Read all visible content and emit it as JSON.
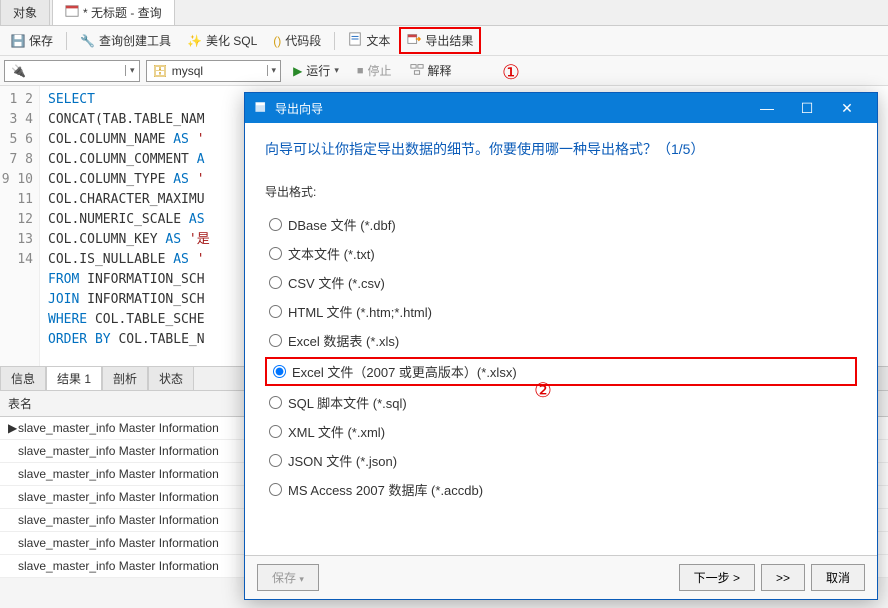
{
  "tabs": {
    "object": "对象",
    "query": "* 无标题 - 查询"
  },
  "toolbar": {
    "save": "保存",
    "query_builder": "查询创建工具",
    "beautify_sql": "美化 SQL",
    "code_snippet": "代码段",
    "text": "文本",
    "export_result": "导出结果"
  },
  "toolbar2": {
    "db": "mysql",
    "run": "运行",
    "stop": "停止",
    "explain": "解释"
  },
  "code": {
    "lines": [
      {
        "n": "1",
        "t": "SELECT",
        "cls": "kw"
      },
      {
        "n": "2",
        "t": "CONCAT(TAB.TABLE_NAM"
      },
      {
        "n": "3",
        "t": "COL.COLUMN_NAME AS '",
        "kw": "AS"
      },
      {
        "n": "4",
        "t": "COL.COLUMN_COMMENT A",
        "kw": ""
      },
      {
        "n": "5",
        "t": "COL.COLUMN_TYPE AS '",
        "kw": "AS"
      },
      {
        "n": "6",
        "t": "COL.CHARACTER_MAXIMU"
      },
      {
        "n": "7",
        "t": "COL.NUMERIC_SCALE AS",
        "kw": "AS"
      },
      {
        "n": "8",
        "t": "COL.COLUMN_KEY AS '是",
        "kw": "AS"
      },
      {
        "n": "9",
        "t": "COL.IS_NULLABLE AS '",
        "kw": "AS"
      },
      {
        "n": "10",
        "t": "FROM INFORMATION_SCH",
        "kw": "FROM"
      },
      {
        "n": "11",
        "t": "JOIN INFORMATION_SCH",
        "kw": "JOIN"
      },
      {
        "n": "12",
        "t": "WHERE COL.TABLE_SCHE",
        "kw": "WHERE"
      },
      {
        "n": "13",
        "t": "ORDER BY COL.TABLE_N",
        "kw": "ORDER BY"
      },
      {
        "n": "14",
        "t": ""
      }
    ]
  },
  "bottom_tabs": {
    "info": "信息",
    "result1": "结果 1",
    "profile": "剖析",
    "status": "状态"
  },
  "grid": {
    "header": "表名",
    "row_value": "slave_master_info Master Information"
  },
  "dialog": {
    "title": "导出向导",
    "heading": "向导可以让你指定导出数据的细节。你要使用哪一种导出格式？（1/5）",
    "format_label": "导出格式:",
    "options": {
      "dbf": "DBase 文件 (*.dbf)",
      "txt": "文本文件 (*.txt)",
      "csv": "CSV 文件 (*.csv)",
      "html": "HTML 文件 (*.htm;*.html)",
      "xls": "Excel 数据表 (*.xls)",
      "xlsx": "Excel 文件（2007 或更高版本）(*.xlsx)",
      "sql": "SQL 脚本文件 (*.sql)",
      "xml": "XML 文件 (*.xml)",
      "json": "JSON 文件 (*.json)",
      "accdb": "MS Access 2007 数据库 (*.accdb)"
    },
    "footer": {
      "save": "保存",
      "next": "下一步 >",
      "skip": ">>",
      "cancel": "取消"
    }
  },
  "annotations": {
    "one": "①",
    "two": "②"
  }
}
